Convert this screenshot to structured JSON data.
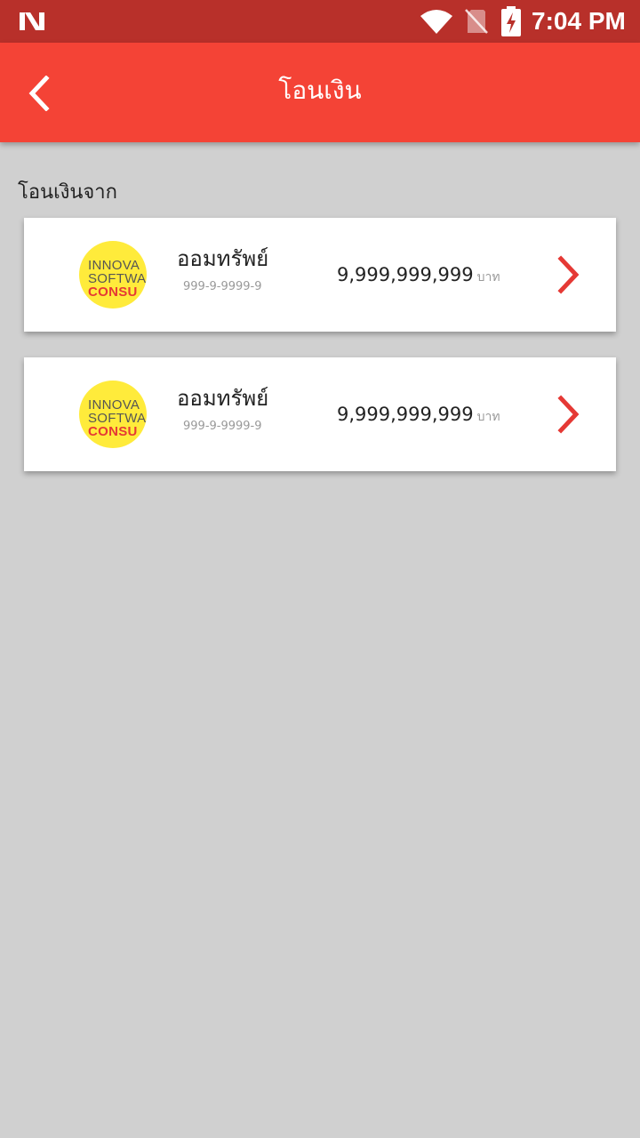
{
  "status_bar": {
    "time": "7:04 PM",
    "icons": [
      "notification-n-icon",
      "wifi-icon",
      "no-sim-icon",
      "battery-charging-icon"
    ]
  },
  "app_bar": {
    "title": "โอนเงิน",
    "back_icon": "chevron-left-icon"
  },
  "section": {
    "label": "โอนเงินจาก"
  },
  "accounts": [
    {
      "logo_lines": [
        "INNOVA",
        "SOFTWA",
        "CONSU"
      ],
      "name": "ออมทรัพย์",
      "number": "999-9-9999-9",
      "balance": "9,999,999,999",
      "unit": "บาท"
    },
    {
      "logo_lines": [
        "INNOVA",
        "SOFTWA",
        "CONSU"
      ],
      "name": "ออมทรัพย์",
      "number": "999-9-9999-9",
      "balance": "9,999,999,999",
      "unit": "บาท"
    }
  ],
  "colors": {
    "status_bar": "#b8302a",
    "app_bar": "#f44336",
    "accent": "#e53935",
    "background": "#d0d0d0",
    "logo_bg": "#ffeb3b"
  }
}
